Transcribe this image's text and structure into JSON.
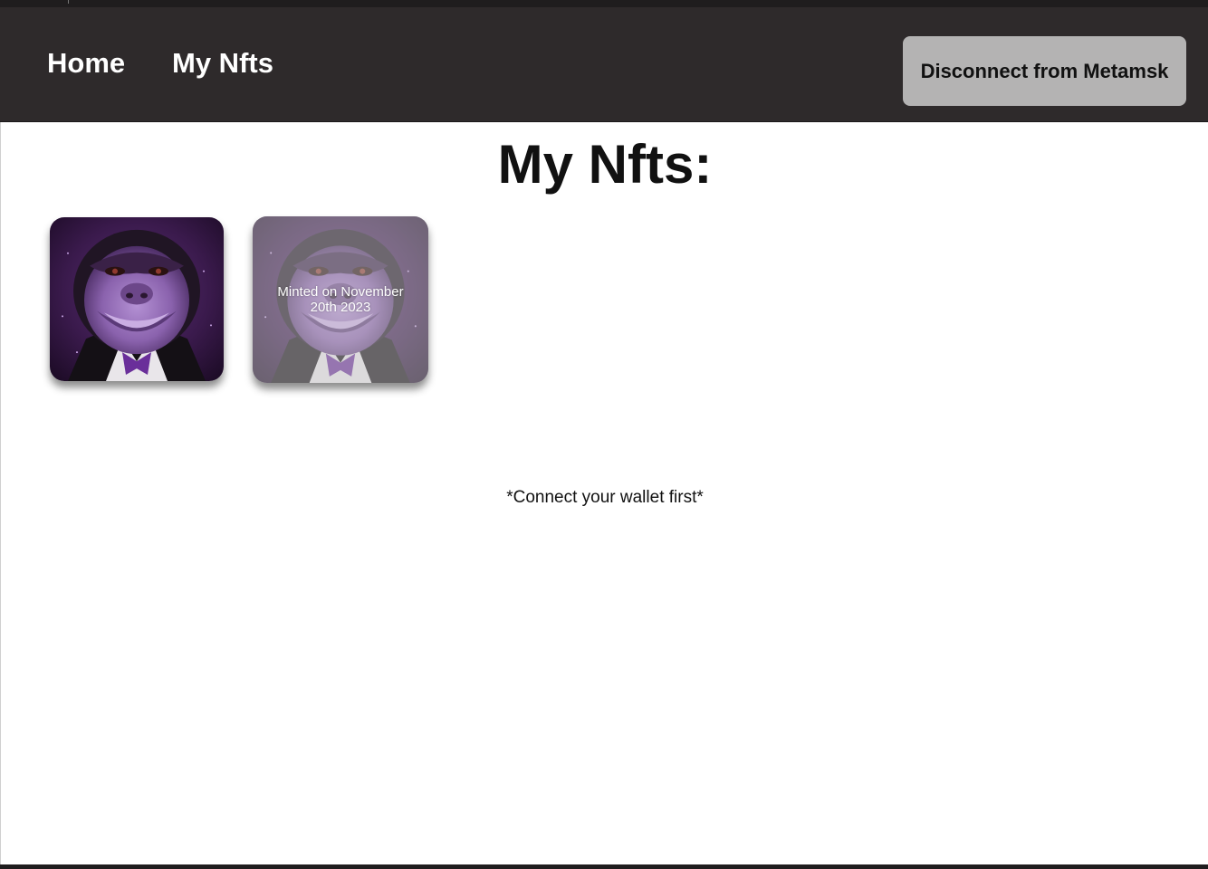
{
  "nav": {
    "home_label": "Home",
    "my_nfts_label": "My Nfts",
    "disconnect_label": "Disconnect from Metamsk"
  },
  "main": {
    "title": "My Nfts:",
    "wallet_note": "*Connect your wallet first*",
    "nfts": [
      {
        "caption": ""
      },
      {
        "caption": "Minted on November 20th 2023"
      }
    ]
  },
  "colors": {
    "navbar_bg": "#2e2a2b",
    "button_bg": "#b4b3b3",
    "nft_purple": "#7b4a9e"
  },
  "icons": {
    "nft_art": "purple-gorilla-in-tuxedo"
  }
}
